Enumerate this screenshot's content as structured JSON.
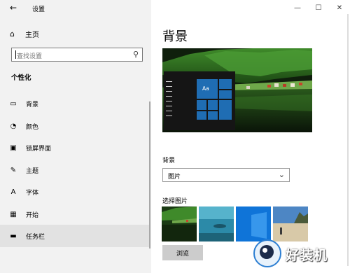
{
  "app": {
    "title": "设置",
    "back_glyph": "←"
  },
  "window_controls": {
    "minimize": "—",
    "maximize": "☐",
    "close": "✕"
  },
  "sidebar": {
    "home_label": "主页",
    "search_placeholder": "查找设置",
    "section_title": "个性化",
    "items": [
      {
        "label": "背景",
        "icon": "image-icon",
        "glyph": "▭"
      },
      {
        "label": "颜色",
        "icon": "palette-icon",
        "glyph": "◔"
      },
      {
        "label": "锁屏界面",
        "icon": "lock-screen-icon",
        "glyph": "▣"
      },
      {
        "label": "主题",
        "icon": "theme-brush-icon",
        "glyph": "✎"
      },
      {
        "label": "字体",
        "icon": "font-icon",
        "glyph": "A"
      },
      {
        "label": "开始",
        "icon": "start-grid-icon",
        "glyph": "▦"
      },
      {
        "label": "任务栏",
        "icon": "taskbar-icon",
        "glyph": "▬"
      }
    ]
  },
  "main": {
    "title": "背景",
    "preview_tile_text": "Aa",
    "background_label": "背景",
    "background_value": "图片",
    "choose_picture_label": "选择图片",
    "browse_label": "浏览"
  },
  "watermark": {
    "text": "好装机"
  },
  "colors": {
    "sidebar_bg": "#f2f2f2",
    "accent_tile": "#1f6db3",
    "hover_bg": "#e2e2e2"
  }
}
